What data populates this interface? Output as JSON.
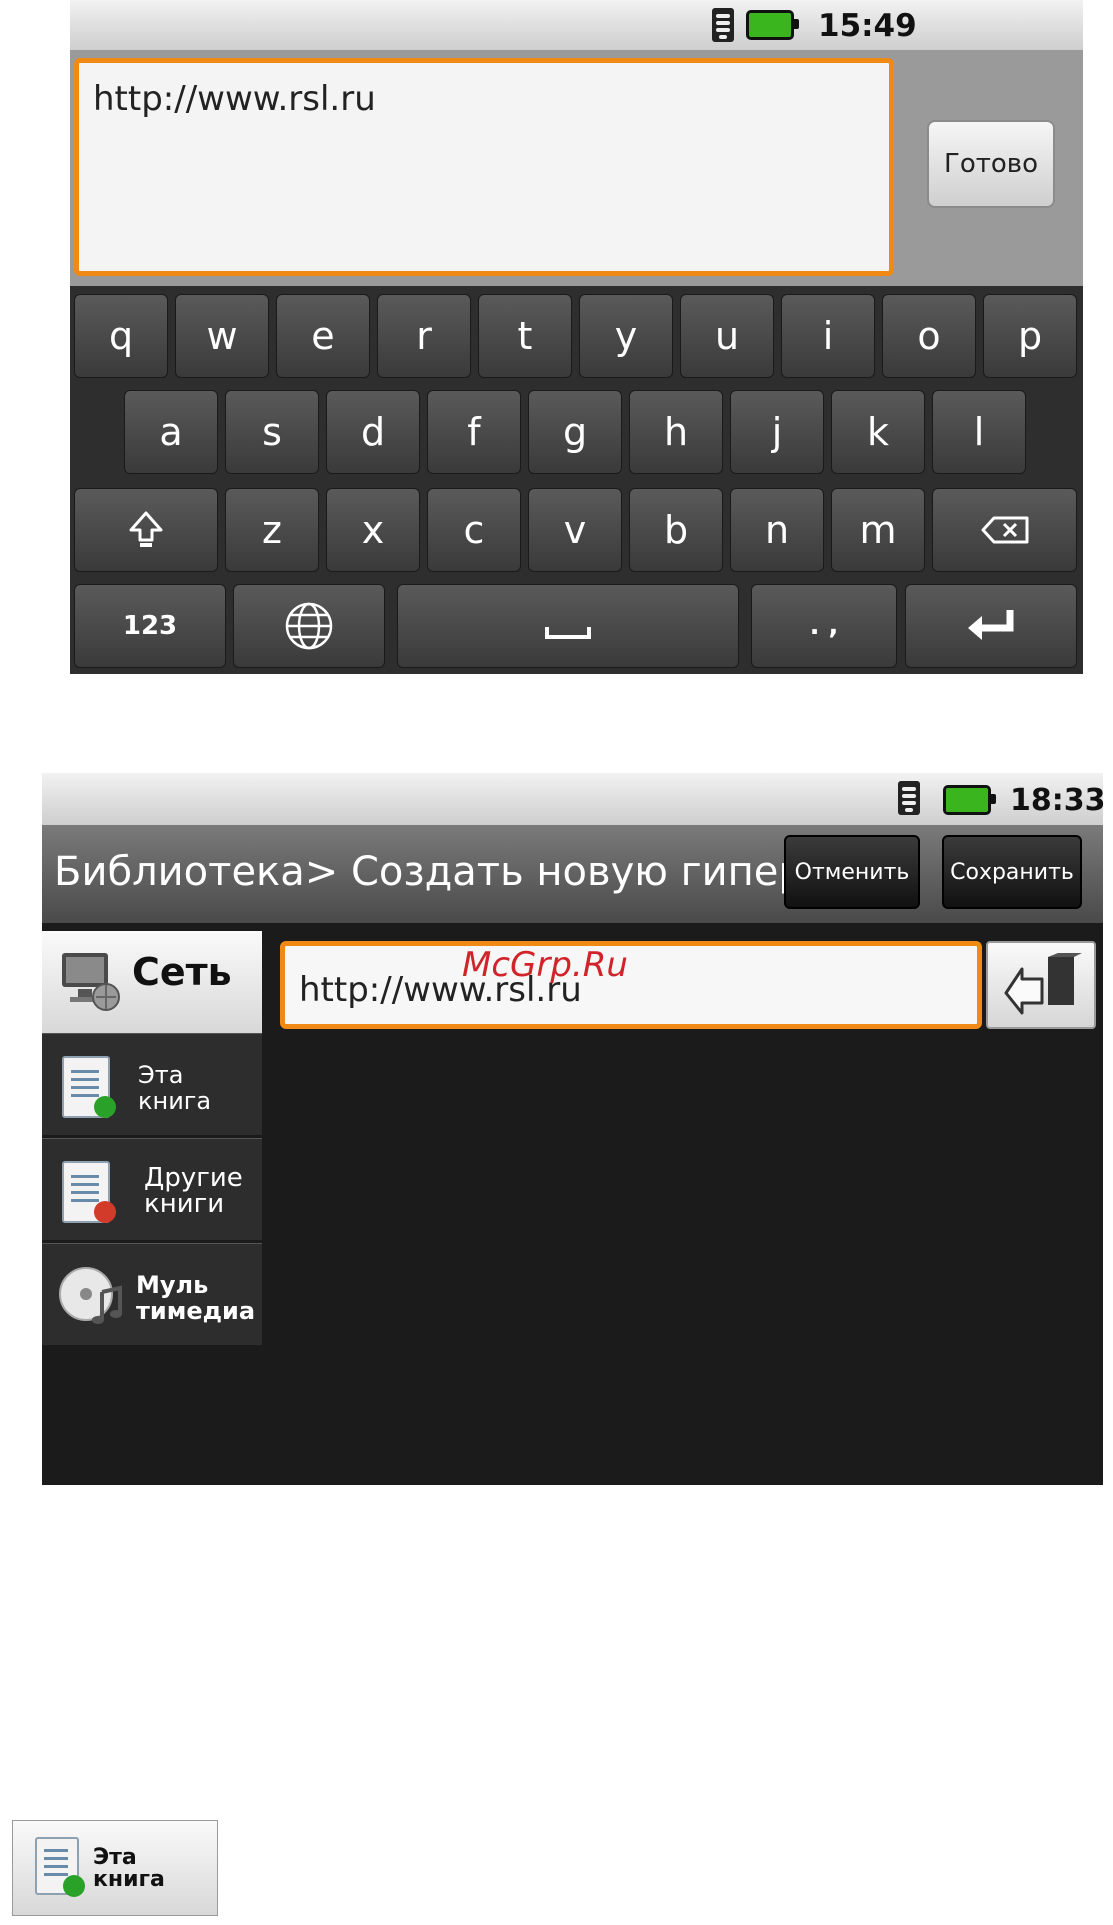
{
  "screen1": {
    "status": {
      "time": "15:49"
    },
    "url_text": "http://www.rsl.ru",
    "done_label": "Готово",
    "keys": {
      "row1": [
        "q",
        "w",
        "e",
        "r",
        "t",
        "y",
        "u",
        "i",
        "o",
        "p"
      ],
      "row2": [
        "a",
        "s",
        "d",
        "f",
        "g",
        "h",
        "j",
        "k",
        "l"
      ],
      "row3": [
        "z",
        "x",
        "c",
        "v",
        "b",
        "n",
        "m"
      ],
      "num_label": "123",
      "punct_label": ". ,"
    }
  },
  "screen2": {
    "status": {
      "time": "18:33"
    },
    "title": "Библиотека> Создать новую гиперссылку",
    "cancel_label": "Отменить",
    "save_label": "Сохранить",
    "sidebar": {
      "items": [
        {
          "label": "Сеть"
        },
        {
          "label": "Эта\nкнига"
        },
        {
          "label": "Другие\nкниги"
        },
        {
          "label": "Муль\nтимедиа"
        }
      ]
    },
    "url_value": "http://www.rsl.ru",
    "watermark": "McGrp.Ru"
  },
  "standalone_button": {
    "label": "Эта\nкнига"
  },
  "colors": {
    "accent": "#f08a14",
    "battery": "#3ab51e",
    "watermark": "#d2232a"
  }
}
